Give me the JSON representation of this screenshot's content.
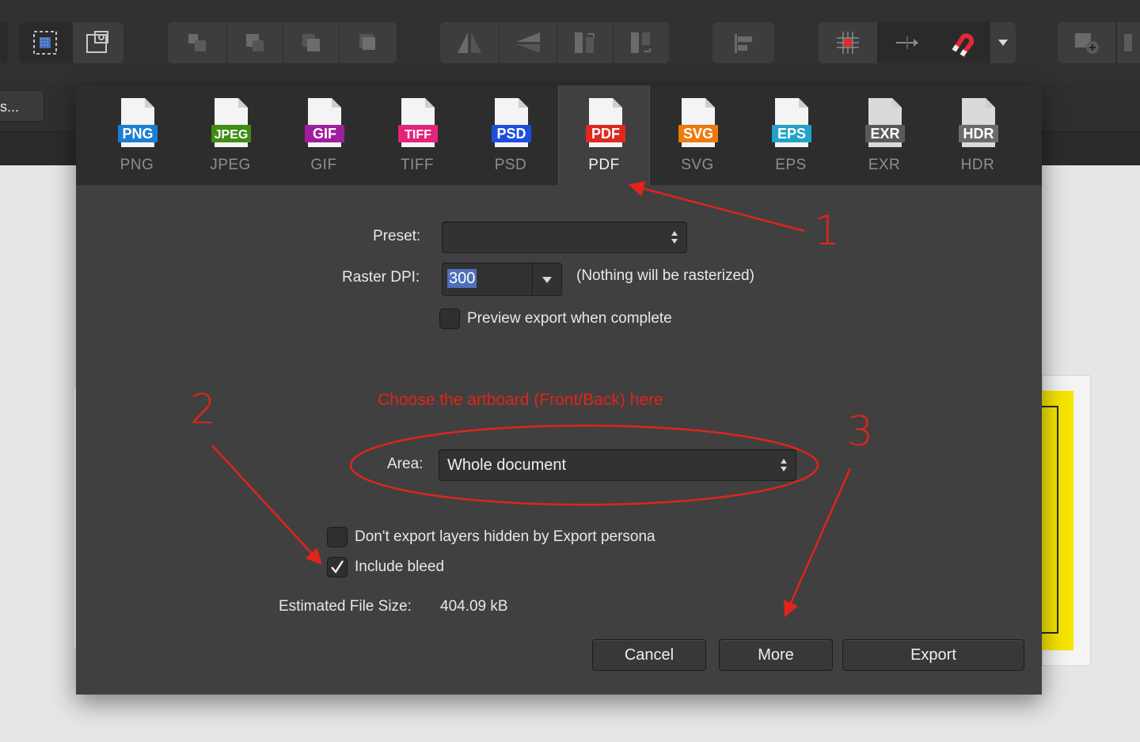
{
  "toolbar": {
    "partial_button_label": "s...",
    "groups": [
      {
        "buttons": [
          "marquee-select-icon",
          "transform-icon"
        ]
      },
      {
        "buttons": [
          "arrange-back-icon",
          "arrange-backward-icon",
          "arrange-forward-icon",
          "arrange-front-icon"
        ]
      },
      {
        "buttons": [
          "flip-horizontal-icon",
          "flip-vertical-icon",
          "rotate-left-icon",
          "rotate-right-icon"
        ]
      },
      {
        "buttons": [
          "align-icon"
        ]
      },
      {
        "buttons": [
          "snap-grid-icon",
          "snap-move-icon",
          "snapping-magnet-icon",
          "dropdown-arrow-icon"
        ]
      },
      {
        "buttons": [
          "add-artboard-icon"
        ]
      }
    ]
  },
  "formats": [
    {
      "name": "PNG",
      "badge": "PNG",
      "color": "#1a7fd4"
    },
    {
      "name": "JPEG",
      "badge": "JPEG",
      "color": "#3f8d14"
    },
    {
      "name": "GIF",
      "badge": "GIF",
      "color": "#a01e9e"
    },
    {
      "name": "TIFF",
      "badge": "TIFF",
      "color": "#e4247a"
    },
    {
      "name": "PSD",
      "badge": "PSD",
      "color": "#1c4fe0"
    },
    {
      "name": "PDF",
      "badge": "PDF",
      "color": "#e0281f",
      "active": true
    },
    {
      "name": "SVG",
      "badge": "SVG",
      "color": "#ef7a0d"
    },
    {
      "name": "EPS",
      "badge": "EPS",
      "color": "#1fa3c8"
    },
    {
      "name": "EXR",
      "badge": "EXR",
      "color": "#5a5a5a"
    },
    {
      "name": "HDR",
      "badge": "HDR",
      "color": "#6a6a6a"
    }
  ],
  "settings": {
    "preset_label": "Preset:",
    "preset_value": "",
    "raster_dpi_label": "Raster DPI:",
    "raster_dpi_value": "300",
    "raster_note": "(Nothing will be rasterized)",
    "preview_label": "Preview export when complete",
    "preview_checked": false,
    "area_label": "Area:",
    "area_value": "Whole document",
    "hidden_layers_label": "Don't export layers hidden by Export persona",
    "hidden_layers_checked": false,
    "include_bleed_label": "Include bleed",
    "include_bleed_checked": true,
    "file_size_label": "Estimated File Size:",
    "file_size_value": "404.09 kB"
  },
  "buttons": {
    "cancel": "Cancel",
    "more": "More",
    "export": "Export"
  },
  "annotations": {
    "area_note": "Choose the artboard (Front/Back) here",
    "marker_1": "1",
    "marker_2": "2",
    "marker_3": "3",
    "color": "#e0241b"
  },
  "colors": {
    "highlight_document": "#f6e500",
    "selection": "#4f6fb8"
  }
}
